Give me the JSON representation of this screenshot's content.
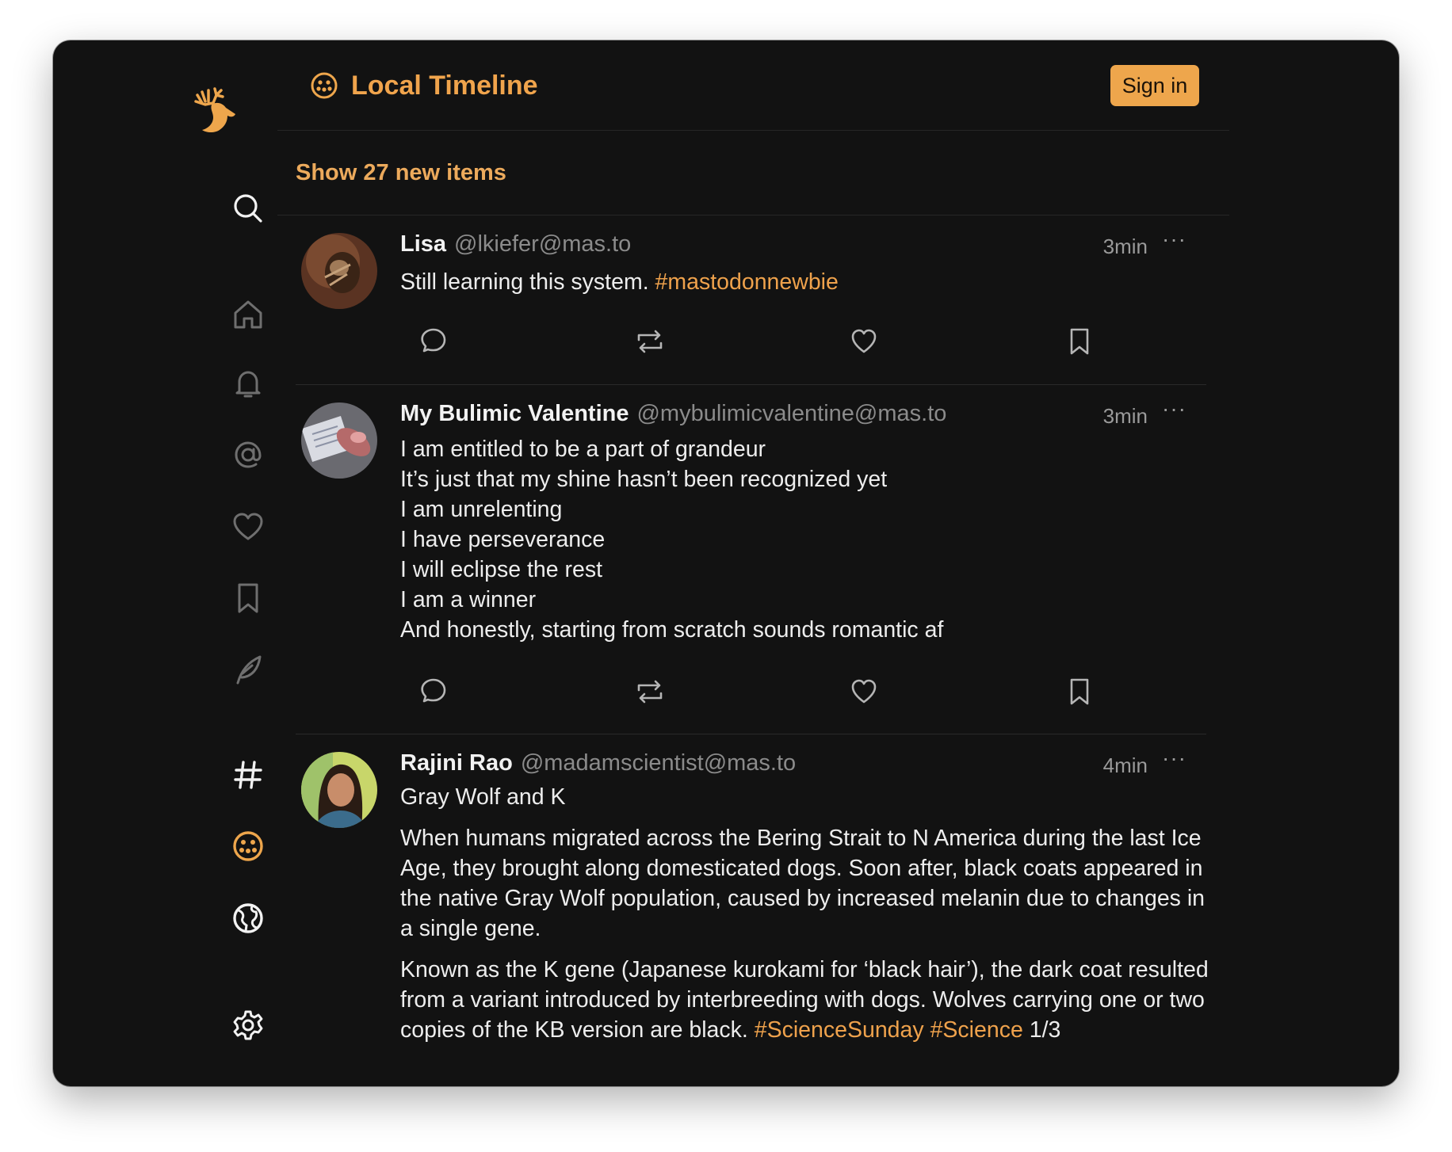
{
  "header": {
    "title": "Local Timeline",
    "sign_in": "Sign in"
  },
  "banner": {
    "label": "Show 27 new items"
  },
  "sidebar": {
    "items": [
      {
        "name": "search",
        "icon": "search-icon",
        "active": false
      },
      {
        "name": "home",
        "icon": "home-icon",
        "active": false
      },
      {
        "name": "notifications",
        "icon": "bell-icon",
        "active": false
      },
      {
        "name": "mentions",
        "icon": "at-icon",
        "active": false
      },
      {
        "name": "favourites",
        "icon": "heart-icon",
        "active": false
      },
      {
        "name": "bookmarks",
        "icon": "bookmark-icon",
        "active": false
      },
      {
        "name": "compose",
        "icon": "feather-icon",
        "active": false
      },
      {
        "name": "hashtags",
        "icon": "hashtag-icon",
        "active": false
      },
      {
        "name": "local-timeline",
        "icon": "local-timeline-icon",
        "active": true
      },
      {
        "name": "federated-timeline",
        "icon": "globe-icon",
        "active": false
      },
      {
        "name": "settings",
        "icon": "gear-icon",
        "active": false
      }
    ]
  },
  "posts": [
    {
      "display_name": "Lisa",
      "acct": "@lkiefer@mas.to",
      "time": "3min",
      "more": "···",
      "text": "Still learning this system. ",
      "hashtag": "#mastodonnewbie"
    },
    {
      "display_name": "My Bulimic Valentine",
      "acct": "@mybulimicvalentine@mas.to",
      "time": "3min",
      "more": "···",
      "lines": [
        "I am entitled to be a part of grandeur",
        "It’s just that my shine hasn’t been recognized yet",
        "I am unrelenting",
        "I have perseverance",
        "I will eclipse the rest",
        "I am a winner",
        "And honestly, starting from scratch sounds romantic af"
      ]
    },
    {
      "display_name": "Rajini Rao",
      "acct": "@madamscientist@mas.to",
      "time": "4min",
      "more": "···",
      "title": "Gray Wolf and K",
      "para1": "When humans migrated across the Bering Strait to N America during the last Ice Age, they brought along domesticated dogs. Soon after, black coats appeared in the native Gray Wolf population, caused by increased melanin due to changes in a single gene.",
      "para2": "Known as the K gene (Japanese kurokami for ‘black hair’), the dark coat resulted from a variant introduced by interbreeding with dogs.  Wolves carrying one or two copies of the KB version are black. ",
      "tag1": "#ScienceSunday",
      "tag2": "#Science",
      "suffix": " 1/3"
    }
  ],
  "colors": {
    "accent": "#eea64c",
    "background": "#121212",
    "text": "#ededed",
    "muted": "#8b8b8b"
  }
}
